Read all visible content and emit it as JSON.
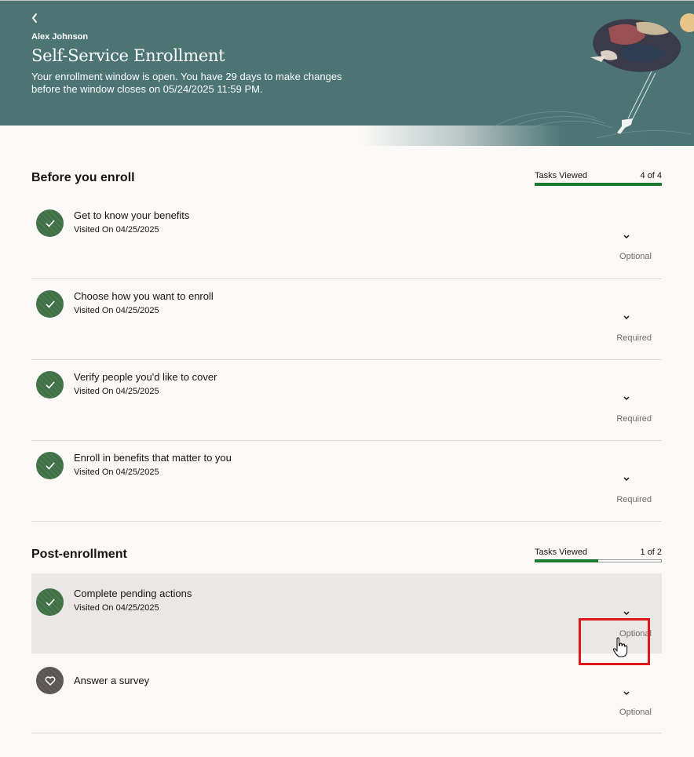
{
  "header": {
    "user_name": "Alex Johnson",
    "title": "Self-Service Enrollment",
    "message": "Your enrollment window is open. You have 29 days to make changes before the window closes on 05/24/2025 11:59 PM."
  },
  "sections": [
    {
      "title": "Before you enroll",
      "tasks_viewed_label": "Tasks Viewed",
      "tasks_viewed_count": "4 of 4",
      "progress": 1.0,
      "tasks": [
        {
          "title": "Get to know your benefits",
          "subtitle": "Visited On 04/25/2025",
          "status": "Optional",
          "icon": "check-icon"
        },
        {
          "title": "Choose how you want to enroll",
          "subtitle": "Visited On 04/25/2025",
          "status": "Required",
          "icon": "check-icon"
        },
        {
          "title": "Verify people you'd like to cover",
          "subtitle": "Visited On 04/25/2025",
          "status": "Required",
          "icon": "check-icon"
        },
        {
          "title": "Enroll in benefits that matter to you",
          "subtitle": "Visited On 04/25/2025",
          "status": "Required",
          "icon": "check-icon"
        }
      ]
    },
    {
      "title": "Post-enrollment",
      "tasks_viewed_label": "Tasks Viewed",
      "tasks_viewed_count": "1 of 2",
      "progress": 0.5,
      "tasks": [
        {
          "title": "Complete pending actions",
          "subtitle": "Visited On 04/25/2025",
          "status": "Optional",
          "icon": "check-icon"
        },
        {
          "title": "Answer a survey",
          "subtitle": "",
          "status": "Optional",
          "icon": "heart-icon"
        }
      ]
    }
  ],
  "colors": {
    "banner": "#4b7473",
    "progress": "#1f7a2e",
    "task_icon": "#3f7045",
    "survey_icon": "#5a5552",
    "highlight": "#e0181a"
  }
}
